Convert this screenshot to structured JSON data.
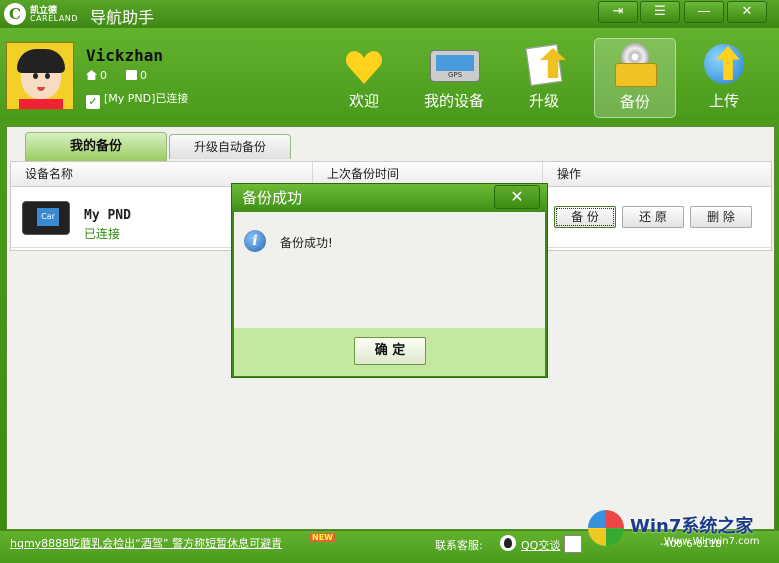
{
  "title_bar": {
    "logo_cn": "凯立德",
    "logo_en": "CARELAND",
    "app_title": "导航助手",
    "buttons": [
      {
        "name": "sync-icon",
        "glyph": "⇥"
      },
      {
        "name": "menu-icon",
        "glyph": "☰"
      },
      {
        "name": "minimize-icon",
        "glyph": "—"
      },
      {
        "name": "close-icon",
        "glyph": "✕"
      }
    ]
  },
  "user": {
    "name": "Vickzhan",
    "home_count": "0",
    "mail_count": "0",
    "device_status": "[My PND]已连接",
    "check_glyph": "✓"
  },
  "nav": [
    {
      "key": "welcome",
      "label": "欢迎",
      "icon": "heart-icon",
      "active": false
    },
    {
      "key": "devices",
      "label": "我的设备",
      "icon": "gps-device-icon",
      "active": false
    },
    {
      "key": "upgrade",
      "label": "升级",
      "icon": "upgrade-icon",
      "active": false
    },
    {
      "key": "backup",
      "label": "备份",
      "icon": "backup-icon",
      "active": true
    },
    {
      "key": "upload",
      "label": "上传",
      "icon": "upload-globe-icon",
      "active": false
    }
  ],
  "device_gps_label": "GPS",
  "tabs": [
    {
      "label": "我的备份",
      "active": true
    },
    {
      "label": "升级自动备份",
      "active": false
    }
  ],
  "table": {
    "columns": [
      "设备名称",
      "上次备份时间",
      "操作"
    ],
    "rows": [
      {
        "device_name": "My PND",
        "status": "已连接",
        "icon_text": "Car",
        "actions": [
          "备 份",
          "还 原",
          "删 除"
        ]
      }
    ]
  },
  "dialog": {
    "title": "备份成功",
    "close_glyph": "✕",
    "info_glyph": "i",
    "message": "备份成功!",
    "ok_label": "确 定"
  },
  "status_bar": {
    "news": "hqmy8888吃蘑乳会检出“酒驾” 警方称短暂休息可避青",
    "new_tag": "NEW",
    "contact_label": "联系客服:",
    "qq_label": "QQ交谈",
    "phone_fragment": "-400-6-0118"
  },
  "watermark": {
    "text": "Win7系统之家",
    "url": "Www.Winwin7.com"
  }
}
